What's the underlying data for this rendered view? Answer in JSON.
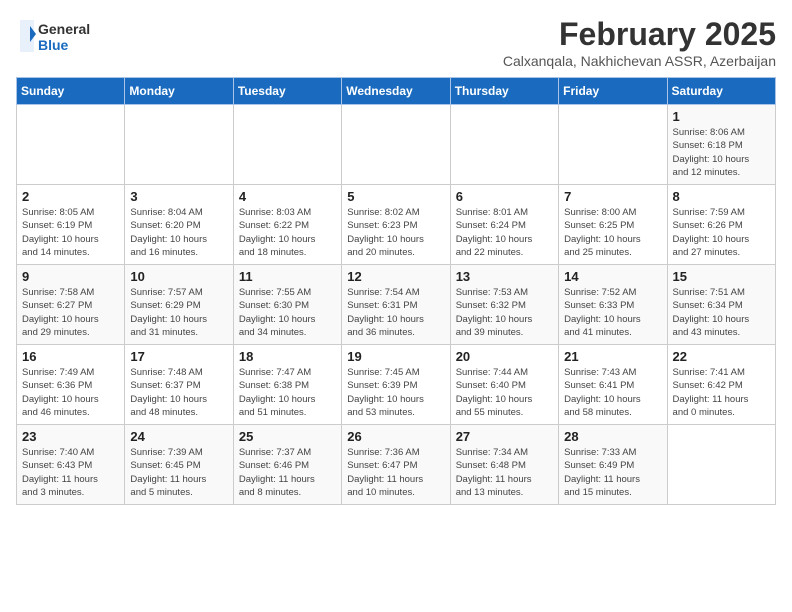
{
  "logo": {
    "general": "General",
    "blue": "Blue"
  },
  "title": "February 2025",
  "subtitle": "Calxanqala, Nakhichevan ASSR, Azerbaijan",
  "days_of_week": [
    "Sunday",
    "Monday",
    "Tuesday",
    "Wednesday",
    "Thursday",
    "Friday",
    "Saturday"
  ],
  "weeks": [
    [
      {
        "day": "",
        "info": ""
      },
      {
        "day": "",
        "info": ""
      },
      {
        "day": "",
        "info": ""
      },
      {
        "day": "",
        "info": ""
      },
      {
        "day": "",
        "info": ""
      },
      {
        "day": "",
        "info": ""
      },
      {
        "day": "1",
        "info": "Sunrise: 8:06 AM\nSunset: 6:18 PM\nDaylight: 10 hours\nand 12 minutes."
      }
    ],
    [
      {
        "day": "2",
        "info": "Sunrise: 8:05 AM\nSunset: 6:19 PM\nDaylight: 10 hours\nand 14 minutes."
      },
      {
        "day": "3",
        "info": "Sunrise: 8:04 AM\nSunset: 6:20 PM\nDaylight: 10 hours\nand 16 minutes."
      },
      {
        "day": "4",
        "info": "Sunrise: 8:03 AM\nSunset: 6:22 PM\nDaylight: 10 hours\nand 18 minutes."
      },
      {
        "day": "5",
        "info": "Sunrise: 8:02 AM\nSunset: 6:23 PM\nDaylight: 10 hours\nand 20 minutes."
      },
      {
        "day": "6",
        "info": "Sunrise: 8:01 AM\nSunset: 6:24 PM\nDaylight: 10 hours\nand 22 minutes."
      },
      {
        "day": "7",
        "info": "Sunrise: 8:00 AM\nSunset: 6:25 PM\nDaylight: 10 hours\nand 25 minutes."
      },
      {
        "day": "8",
        "info": "Sunrise: 7:59 AM\nSunset: 6:26 PM\nDaylight: 10 hours\nand 27 minutes."
      }
    ],
    [
      {
        "day": "9",
        "info": "Sunrise: 7:58 AM\nSunset: 6:27 PM\nDaylight: 10 hours\nand 29 minutes."
      },
      {
        "day": "10",
        "info": "Sunrise: 7:57 AM\nSunset: 6:29 PM\nDaylight: 10 hours\nand 31 minutes."
      },
      {
        "day": "11",
        "info": "Sunrise: 7:55 AM\nSunset: 6:30 PM\nDaylight: 10 hours\nand 34 minutes."
      },
      {
        "day": "12",
        "info": "Sunrise: 7:54 AM\nSunset: 6:31 PM\nDaylight: 10 hours\nand 36 minutes."
      },
      {
        "day": "13",
        "info": "Sunrise: 7:53 AM\nSunset: 6:32 PM\nDaylight: 10 hours\nand 39 minutes."
      },
      {
        "day": "14",
        "info": "Sunrise: 7:52 AM\nSunset: 6:33 PM\nDaylight: 10 hours\nand 41 minutes."
      },
      {
        "day": "15",
        "info": "Sunrise: 7:51 AM\nSunset: 6:34 PM\nDaylight: 10 hours\nand 43 minutes."
      }
    ],
    [
      {
        "day": "16",
        "info": "Sunrise: 7:49 AM\nSunset: 6:36 PM\nDaylight: 10 hours\nand 46 minutes."
      },
      {
        "day": "17",
        "info": "Sunrise: 7:48 AM\nSunset: 6:37 PM\nDaylight: 10 hours\nand 48 minutes."
      },
      {
        "day": "18",
        "info": "Sunrise: 7:47 AM\nSunset: 6:38 PM\nDaylight: 10 hours\nand 51 minutes."
      },
      {
        "day": "19",
        "info": "Sunrise: 7:45 AM\nSunset: 6:39 PM\nDaylight: 10 hours\nand 53 minutes."
      },
      {
        "day": "20",
        "info": "Sunrise: 7:44 AM\nSunset: 6:40 PM\nDaylight: 10 hours\nand 55 minutes."
      },
      {
        "day": "21",
        "info": "Sunrise: 7:43 AM\nSunset: 6:41 PM\nDaylight: 10 hours\nand 58 minutes."
      },
      {
        "day": "22",
        "info": "Sunrise: 7:41 AM\nSunset: 6:42 PM\nDaylight: 11 hours\nand 0 minutes."
      }
    ],
    [
      {
        "day": "23",
        "info": "Sunrise: 7:40 AM\nSunset: 6:43 PM\nDaylight: 11 hours\nand 3 minutes."
      },
      {
        "day": "24",
        "info": "Sunrise: 7:39 AM\nSunset: 6:45 PM\nDaylight: 11 hours\nand 5 minutes."
      },
      {
        "day": "25",
        "info": "Sunrise: 7:37 AM\nSunset: 6:46 PM\nDaylight: 11 hours\nand 8 minutes."
      },
      {
        "day": "26",
        "info": "Sunrise: 7:36 AM\nSunset: 6:47 PM\nDaylight: 11 hours\nand 10 minutes."
      },
      {
        "day": "27",
        "info": "Sunrise: 7:34 AM\nSunset: 6:48 PM\nDaylight: 11 hours\nand 13 minutes."
      },
      {
        "day": "28",
        "info": "Sunrise: 7:33 AM\nSunset: 6:49 PM\nDaylight: 11 hours\nand 15 minutes."
      },
      {
        "day": "",
        "info": ""
      }
    ]
  ]
}
